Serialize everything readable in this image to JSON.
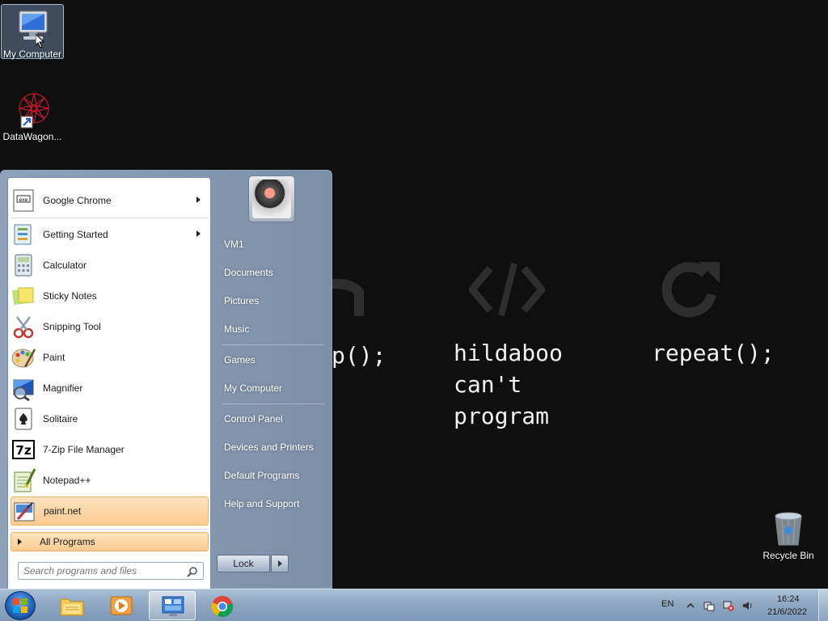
{
  "desktop": {
    "icons": [
      {
        "label": "My Computer"
      },
      {
        "label": "DataWagon..."
      },
      {
        "label": "Recycle Bin"
      }
    ],
    "wallpaper": {
      "col1_text": "p();",
      "col2_text": "hildaboo\ncan't\nprogram",
      "col3_text": "repeat();"
    }
  },
  "start_menu": {
    "programs": [
      {
        "label": "Google Chrome",
        "icon": "chrome-icon",
        "submenu": true
      },
      {
        "label": "Getting Started",
        "icon": "getting-started-icon",
        "submenu": true
      },
      {
        "label": "Calculator",
        "icon": "calculator-icon",
        "submenu": false
      },
      {
        "label": "Sticky Notes",
        "icon": "sticky-notes-icon",
        "submenu": false
      },
      {
        "label": "Snipping Tool",
        "icon": "snipping-tool-icon",
        "submenu": false
      },
      {
        "label": "Paint",
        "icon": "paint-icon",
        "submenu": false
      },
      {
        "label": "Magnifier",
        "icon": "magnifier-icon",
        "submenu": false
      },
      {
        "label": "Solitaire",
        "icon": "solitaire-icon",
        "submenu": false
      },
      {
        "label": "7-Zip File Manager",
        "icon": "7zip-icon",
        "submenu": false
      },
      {
        "label": "Notepad++",
        "icon": "notepadpp-icon",
        "submenu": false
      },
      {
        "label": "paint.net",
        "icon": "paintnet-icon",
        "submenu": false,
        "highlighted": true
      }
    ],
    "all_programs_label": "All Programs",
    "search_placeholder": "Search programs and files",
    "right_links": [
      {
        "label": "VM1"
      },
      {
        "label": "Documents"
      },
      {
        "label": "Pictures"
      },
      {
        "label": "Music"
      },
      {
        "label": "Games"
      },
      {
        "label": "My Computer"
      },
      {
        "label": "Control Panel"
      },
      {
        "label": "Devices and Printers"
      },
      {
        "label": "Default Programs"
      },
      {
        "label": "Help and Support"
      }
    ],
    "lock_label": "Lock"
  },
  "taskbar": {
    "pinned": [
      "windows-explorer-icon",
      "media-player-icon",
      "start-menu-app-icon",
      "chrome-icon"
    ],
    "language": "EN",
    "time": "16:24",
    "date": "21/6/2022"
  },
  "colors": {
    "highlight": "#fbcb8f",
    "taskbar": "#8fa7c1",
    "wallpaper": "#0f0f0f"
  }
}
